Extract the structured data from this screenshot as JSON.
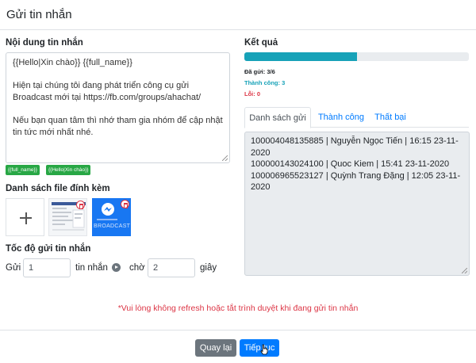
{
  "header": {
    "title": "Gửi tin nhắn"
  },
  "message": {
    "section_title": "Nội dung tin nhắn",
    "lines": [
      "{{Hello|Xin chào}} {{full_name}}",
      "",
      "Hiện tại chúng tôi đang phát triển công cụ gửi Broadcast mới tại https://fb.com/groups/ahachat/",
      "",
      "Nếu bạn quan tâm thì nhớ tham gia nhóm để cập nhật tin tức mới nhất nhé."
    ],
    "tags": [
      "{{full_name}}",
      "{{Hello|Xin chào}}"
    ]
  },
  "attachments": {
    "section_title": "Danh sách file đính kèm",
    "thumb_2_text": "BROADCAST"
  },
  "speed": {
    "section_title": "Tốc độ gửi tin nhắn",
    "send_label": "Gửi",
    "send_value": "1",
    "msg_label": "tin nhắn",
    "wait_label": "chờ",
    "wait_value": "2",
    "sec_label": "giây"
  },
  "result": {
    "section_title": "Kết quả",
    "progress": 0.5,
    "sent": "Đã gửi: 3/6",
    "success": "Thành công: 3",
    "error": "Lỗi: 0",
    "tabs": [
      "Danh sách gửi",
      "Thành công",
      "Thất bại"
    ],
    "list": [
      "100004048135885 | Nguyễn Ngọc Tiến | 16:15 23-11-2020",
      "100000143024100 | Quoc Kiem | 15:41 23-11-2020",
      "100006965523127 | Quỳnh Trang Đặng | 12:05 23-11-2020"
    ]
  },
  "warning": "*Vui lòng không refresh hoặc tắt trình duyệt khi đang gửi tin nhắn",
  "footer": {
    "back_label": "Quay lại",
    "next_label": "Tiếp tục"
  },
  "colors": {
    "primary": "#007bff",
    "success": "#28a745",
    "info": "#17a2b8",
    "danger": "#dc3545",
    "secondary": "#6c757d"
  }
}
